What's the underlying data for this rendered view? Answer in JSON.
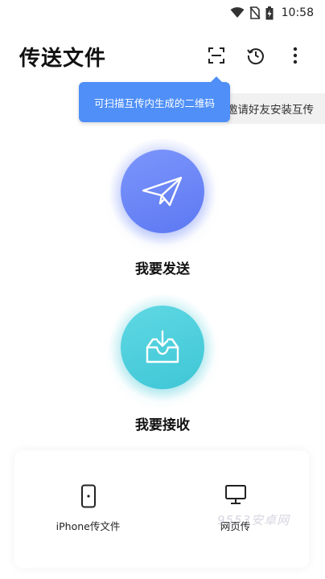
{
  "status_bar": {
    "time": "10:58"
  },
  "header": {
    "title": "传送文件",
    "scan_icon": "scan-icon",
    "history_icon": "history-icon",
    "more_icon": "more-vertical-icon"
  },
  "tooltip": {
    "text": "可扫描互传内生成的二维码"
  },
  "marquee": {
    "text": "邀请好友安装互传"
  },
  "actions": {
    "send_label": "我要发送",
    "receive_label": "我要接收"
  },
  "bottom": {
    "iphone_label": "iPhone传文件",
    "web_label": "网页传"
  },
  "watermark": "9553安卓网",
  "colors": {
    "send": "#6b86f7",
    "receive": "#4ccfdd",
    "tooltip": "#4f8ff7"
  }
}
